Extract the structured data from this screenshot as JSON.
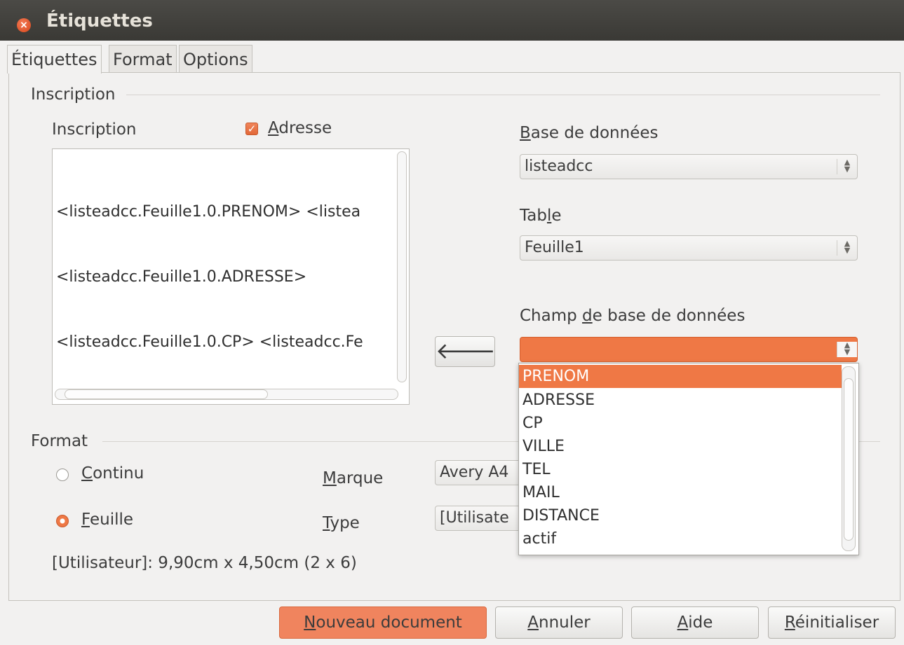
{
  "window": {
    "title": "Étiquettes"
  },
  "tabs": [
    {
      "label": "Étiquettes",
      "active": true
    },
    {
      "label": "Format",
      "active": false
    },
    {
      "label": "Options",
      "active": false
    }
  ],
  "inscription_section": {
    "title": "Inscription",
    "label": "Inscription",
    "address_checkbox": {
      "label_prefix": "",
      "label_underline": "A",
      "label_rest": "dresse",
      "checked": true
    },
    "text_lines": [
      "<listeadcc.Feuille1.0.PRENOM> <listea",
      "<listeadcc.Feuille1.0.ADRESSE>",
      "<listeadcc.Feuille1.0.CP> <listeadcc.Fe"
    ],
    "insert_button_icon": "arrow-left-icon"
  },
  "database": {
    "label_underline": "B",
    "label_rest": "ase de données",
    "value": "listeadcc"
  },
  "table": {
    "label_prefix": "Tab",
    "label_underline": "l",
    "label_rest": "e",
    "value": "Feuille1"
  },
  "field": {
    "label_prefix": "Champ ",
    "label_underline": "d",
    "label_rest": "e base de données",
    "value": "",
    "options": [
      "PRENOM",
      "ADRESSE",
      "CP",
      "VILLE",
      "TEL",
      "MAIL",
      "DISTANCE",
      "actif"
    ],
    "selected_index": 0
  },
  "format_section": {
    "title": "Format",
    "continu": {
      "label_underline": "C",
      "label_rest": "ontinu",
      "selected": false
    },
    "feuille": {
      "label_underline": "F",
      "label_rest": "euille",
      "selected": true
    },
    "marque": {
      "label_underline": "M",
      "label_rest": "arque",
      "value": "Avery A4"
    },
    "type": {
      "label_underline": "T",
      "label_rest": "ype",
      "value": "[Utilisate"
    },
    "summary": "[Utilisateur]: 9,90cm x 4,50cm (2 x 6)"
  },
  "buttons": {
    "new_doc": {
      "underline": "N",
      "rest": "ouveau document"
    },
    "cancel": {
      "underline": "A",
      "rest": "nnuler"
    },
    "help": {
      "underline": "A",
      "rest": "ide"
    },
    "reset": {
      "underline": "R",
      "rest": "éinitialiser"
    }
  },
  "colors": {
    "accent": "#ef7845",
    "titlebar": "#3c3b37"
  }
}
